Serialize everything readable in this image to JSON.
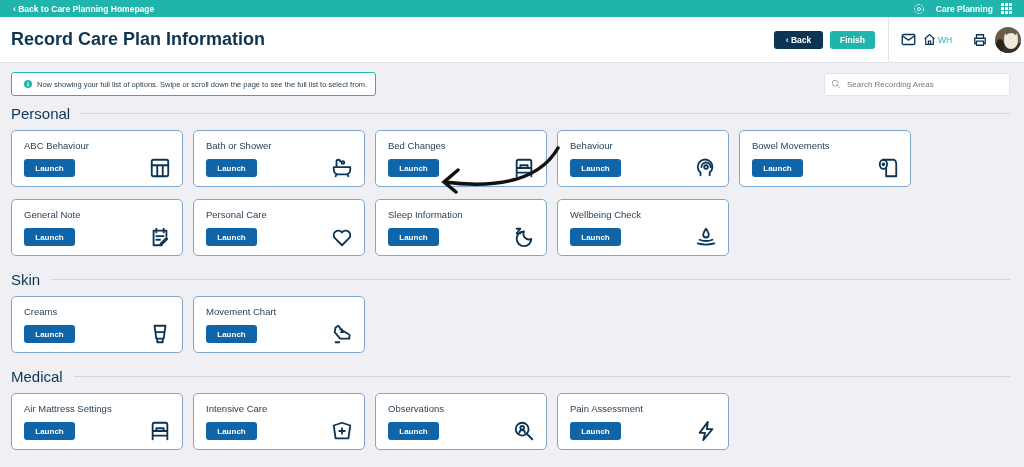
{
  "top_bar": {
    "back_link": "‹ Back to Care Planning Homepage",
    "app_name": "Care Planning"
  },
  "header": {
    "title": "Record Care Plan Information",
    "back_button": "‹ Back",
    "finish_button": "Finish",
    "location": "WH"
  },
  "info_message": "Now showing your full list of options. Swipe or scroll down the page to see the full list to select from.",
  "search": {
    "placeholder": "Search Recording Areas"
  },
  "sections": [
    {
      "title": "Personal",
      "cards": [
        {
          "title": "ABC Behaviour",
          "button": "Launch"
        },
        {
          "title": "Bath or Shower",
          "button": "Launch"
        },
        {
          "title": "Bed Changes",
          "button": "Launch"
        },
        {
          "title": "Behaviour",
          "button": "Launch"
        },
        {
          "title": "Bowel Movements",
          "button": "Launch"
        },
        {
          "title": "General Note",
          "button": "Launch"
        },
        {
          "title": "Personal Care",
          "button": "Launch"
        },
        {
          "title": "Sleep Information",
          "button": "Launch"
        },
        {
          "title": "Wellbeing Check",
          "button": "Launch"
        }
      ]
    },
    {
      "title": "Skin",
      "cards": [
        {
          "title": "Creams",
          "button": "Launch"
        },
        {
          "title": "Movement Chart",
          "button": "Launch"
        }
      ]
    },
    {
      "title": "Medical",
      "cards": [
        {
          "title": "Air Mattress Settings",
          "button": "Launch"
        },
        {
          "title": "Intensive Care",
          "button": "Launch"
        },
        {
          "title": "Observations",
          "button": "Launch"
        },
        {
          "title": "Pain Assessment",
          "button": "Launch"
        }
      ]
    }
  ]
}
